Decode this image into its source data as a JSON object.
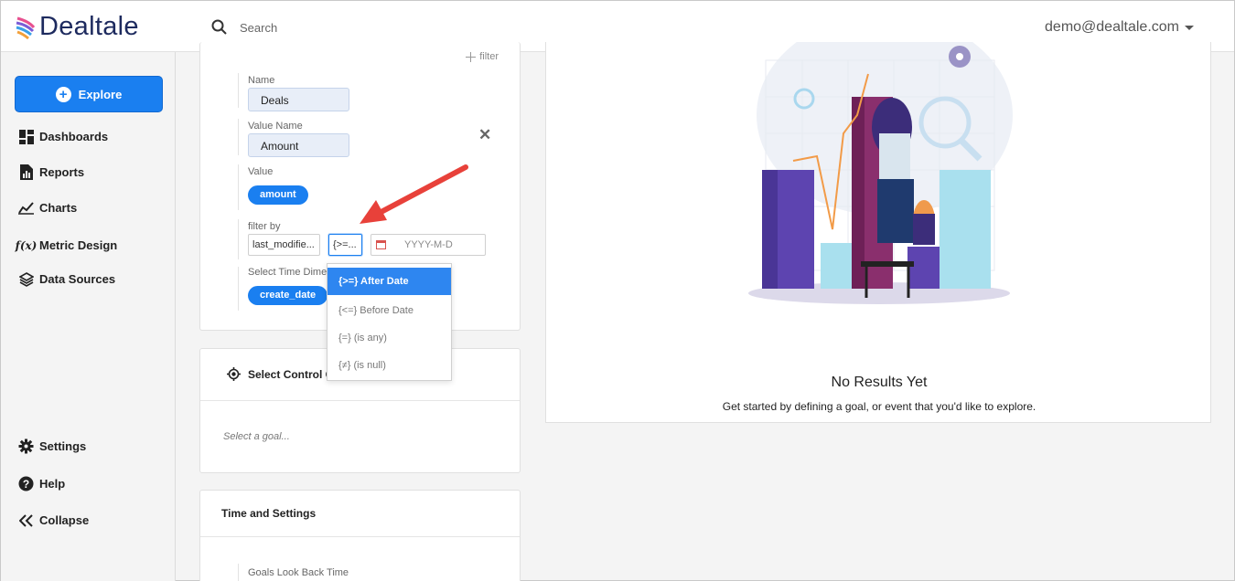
{
  "header": {
    "logo_text": "Dealtale",
    "search_placeholder": "Search",
    "user_email": "demo@dealtale.com"
  },
  "sidebar": {
    "explore_label": "Explore",
    "items": [
      {
        "label": "Dashboards",
        "icon": "dashboard-icon"
      },
      {
        "label": "Reports",
        "icon": "report-icon"
      },
      {
        "label": "Charts",
        "icon": "chart-icon"
      },
      {
        "label": "Metric Design",
        "icon": "function-icon"
      },
      {
        "label": "Data Sources",
        "icon": "layers-icon"
      }
    ],
    "bottom_items": [
      {
        "label": "Settings",
        "icon": "gear-icon"
      },
      {
        "label": "Help",
        "icon": "help-icon"
      },
      {
        "label": "Collapse",
        "icon": "collapse-icon"
      }
    ]
  },
  "metric_card": {
    "filter_link": "filter",
    "name_label": "Name",
    "name_value": "Deals",
    "value_name_label": "Value Name",
    "value_name_value": "Amount",
    "value_label": "Value",
    "value_pill": "amount",
    "filter_by_label": "filter by",
    "filter_field": "last_modifie...",
    "filter_operator": "{>=...",
    "date_placeholder": "YYYY-M-D",
    "time_dim_label": "Select Time Dimer",
    "time_dim_pill": "create_date"
  },
  "operator_dropdown": {
    "options": [
      "{>=} After Date",
      "{<=} Before Date",
      "{=} (is any)",
      "{≠} (is null)"
    ],
    "selected_index": 0
  },
  "control_group_card": {
    "title": "Select Control G",
    "placeholder": "Select a goal..."
  },
  "time_settings_card": {
    "title": "Time and Settings",
    "look_back_label": "Goals Look Back Time"
  },
  "results": {
    "title": "No Results Yet",
    "subtitle": "Get started by defining a goal, or event that you'd like to explore."
  },
  "colors": {
    "accent": "#1a7ff0",
    "annotation_arrow": "#e8413a"
  }
}
